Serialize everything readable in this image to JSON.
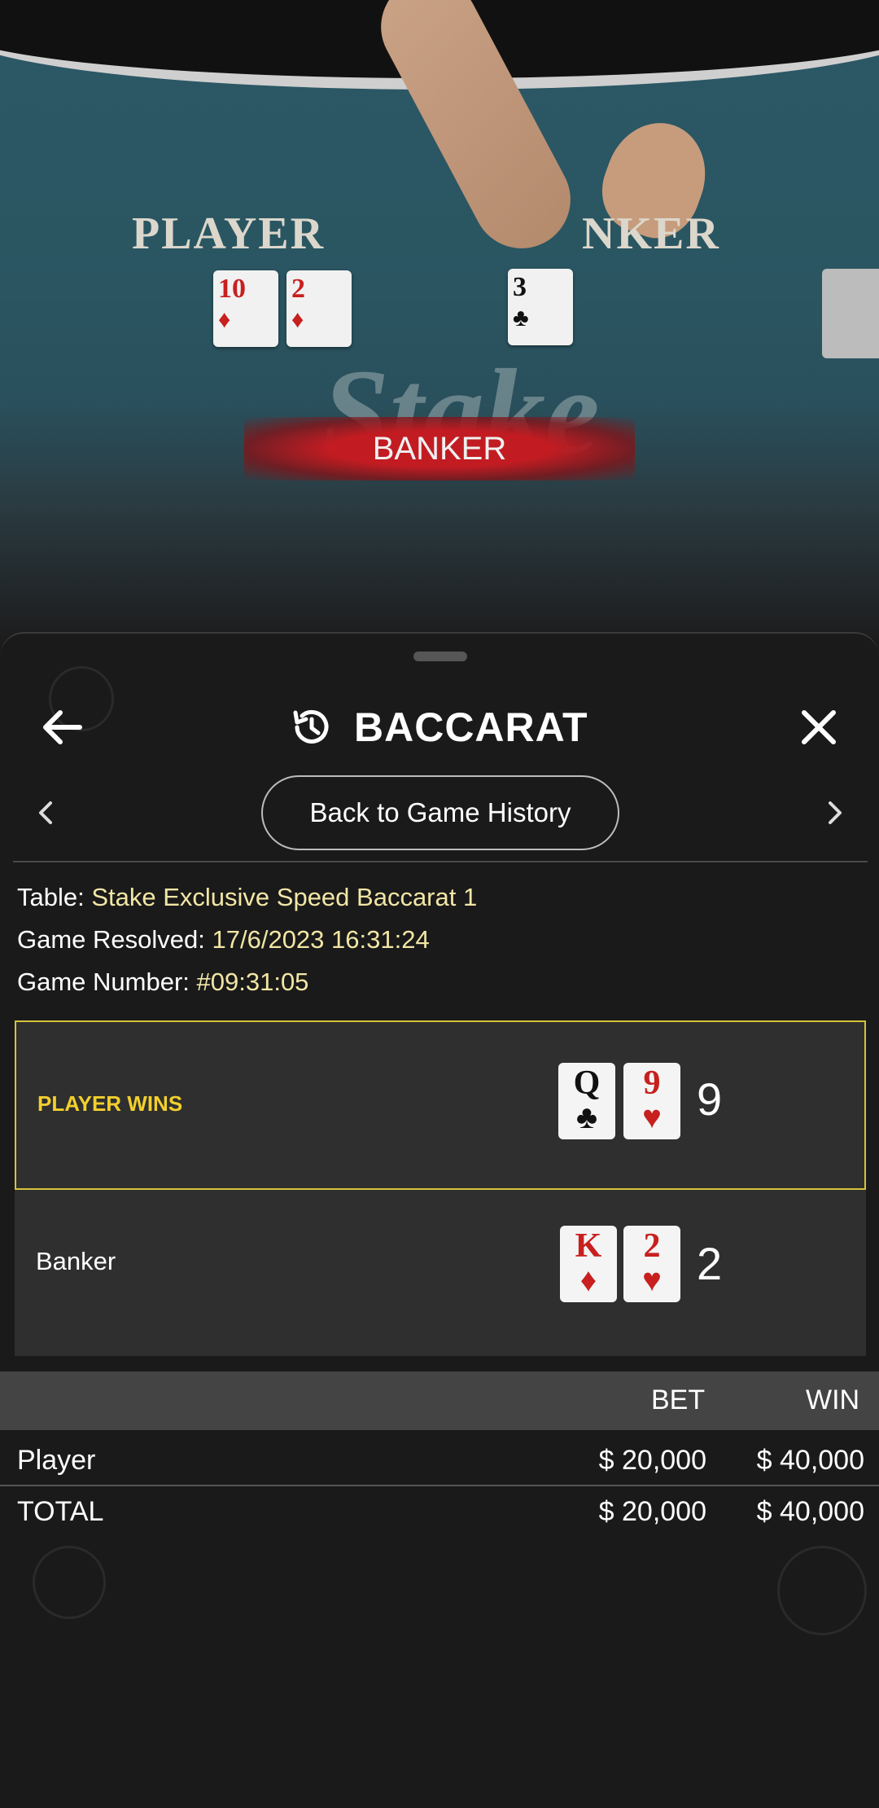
{
  "video": {
    "felt_player": "PLAYER",
    "felt_banker": "NKER",
    "felt_cards_player": [
      {
        "rank": "10",
        "suit": "♦",
        "color": "red"
      },
      {
        "rank": "2",
        "suit": "♦",
        "color": "red"
      }
    ],
    "felt_cards_banker": [
      {
        "rank": "3",
        "suit": "♣",
        "color": "black"
      }
    ],
    "watermark": "Stake",
    "result_banner": "BANKER"
  },
  "sheet": {
    "title": "BACCARAT",
    "back_to_history": "Back to Game History",
    "info": {
      "table_label": "Table: ",
      "table_value": "Stake Exclusive Speed Baccarat 1",
      "resolved_label": "Game Resolved: ",
      "resolved_value": "17/6/2023 16:31:24",
      "number_label": "Game Number: ",
      "number_value": "#09:31:05"
    },
    "player_panel": {
      "label": "PLAYER WINS",
      "cards": [
        {
          "rank": "Q",
          "suit": "♣",
          "color": "black"
        },
        {
          "rank": "9",
          "suit": "♥",
          "color": "red"
        }
      ],
      "score": "9"
    },
    "banker_panel": {
      "label": "Banker",
      "cards": [
        {
          "rank": "K",
          "suit": "♦",
          "color": "red"
        },
        {
          "rank": "2",
          "suit": "♥",
          "color": "red"
        }
      ],
      "score": "2"
    },
    "bets": {
      "header_bet": "BET",
      "header_win": "WIN",
      "rows": [
        {
          "label": "Player",
          "bet": "$ 20,000",
          "win": "$ 40,000"
        }
      ],
      "total": {
        "label": "TOTAL",
        "bet": "$ 20,000",
        "win": "$ 40,000"
      }
    },
    "colors": {
      "accent_yellow": "#f2cf2d",
      "info_value": "#f2e6a5",
      "card_red": "#c7201f"
    }
  }
}
